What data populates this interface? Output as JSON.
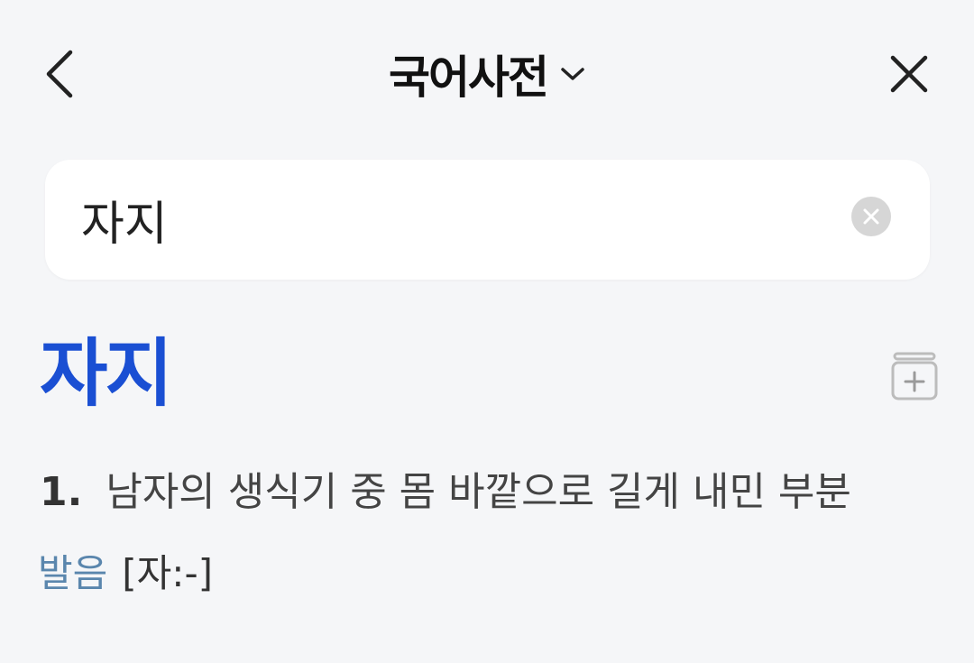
{
  "header": {
    "title": "국어사전",
    "back_icon": "chevron-left-icon",
    "dropdown_icon": "chevron-down-icon",
    "close_icon": "close-icon"
  },
  "search": {
    "value": "자지",
    "clear_icon": "clear-circle-icon"
  },
  "entry": {
    "word": "자지",
    "word_color": "#1a4fd3",
    "wordbook_icon": "wordbook-add-icon",
    "definitions": [
      {
        "number": "1.",
        "text": "남자의 생식기 중 몸 바깥으로 길게 내민 부분"
      }
    ],
    "pronunciation": {
      "label": "발음",
      "value": "[자:-]",
      "label_color": "#5a86ad"
    }
  }
}
